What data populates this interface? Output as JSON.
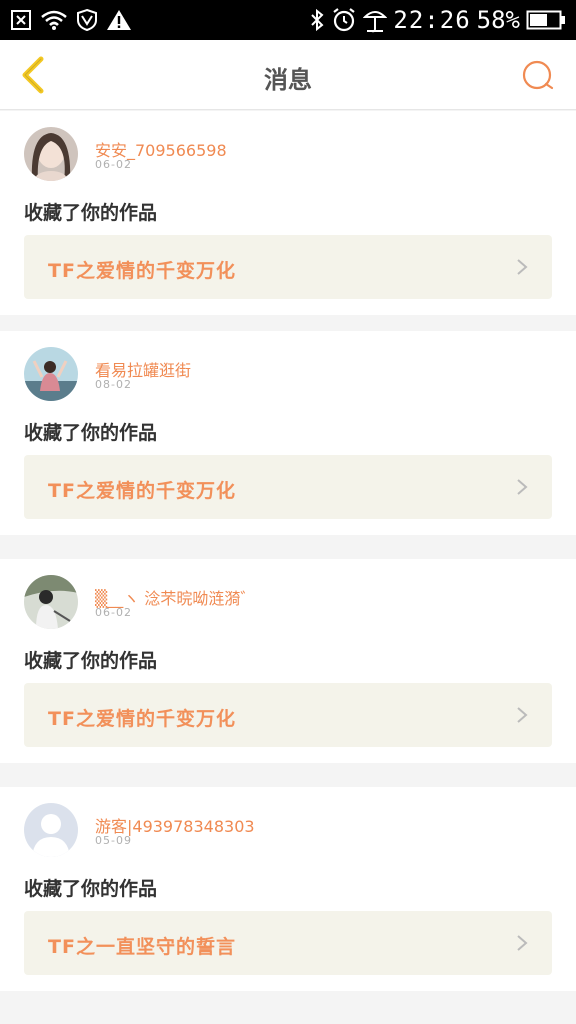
{
  "status_bar": {
    "time": "22:26",
    "battery": "58%",
    "icons": [
      "close-box-icon",
      "wifi-icon",
      "vpn-shield-icon",
      "warning-icon",
      "bluetooth-icon",
      "alarm-icon",
      "weather-icon",
      "battery-icon"
    ]
  },
  "header": {
    "title": "消息",
    "back_icon": "chevron-left-icon",
    "search_icon": "search-icon"
  },
  "colors": {
    "accent": "#f08a52",
    "back_arrow": "#f3c823",
    "card_link_bg": "#f4f3ea"
  },
  "messages": [
    {
      "username": "安安_709566598",
      "date": "06-02",
      "action": "收藏了你的作品",
      "work_title": "TF之爱情的千变万化"
    },
    {
      "username": "看易拉罐逛街",
      "date": "08-02",
      "action": "收藏了你的作品",
      "work_title": "TF之爱情的千变万化"
    },
    {
      "username": "▒__ヽ 淰芣晥呦涟漪゛",
      "date": "06-02",
      "action": "收藏了你的作品",
      "work_title": "TF之爱情的千变万化"
    },
    {
      "username": "游客|493978348303",
      "date": "05-09",
      "action": "收藏了你的作品",
      "work_title": "TF之一直坚守的誓言"
    }
  ]
}
